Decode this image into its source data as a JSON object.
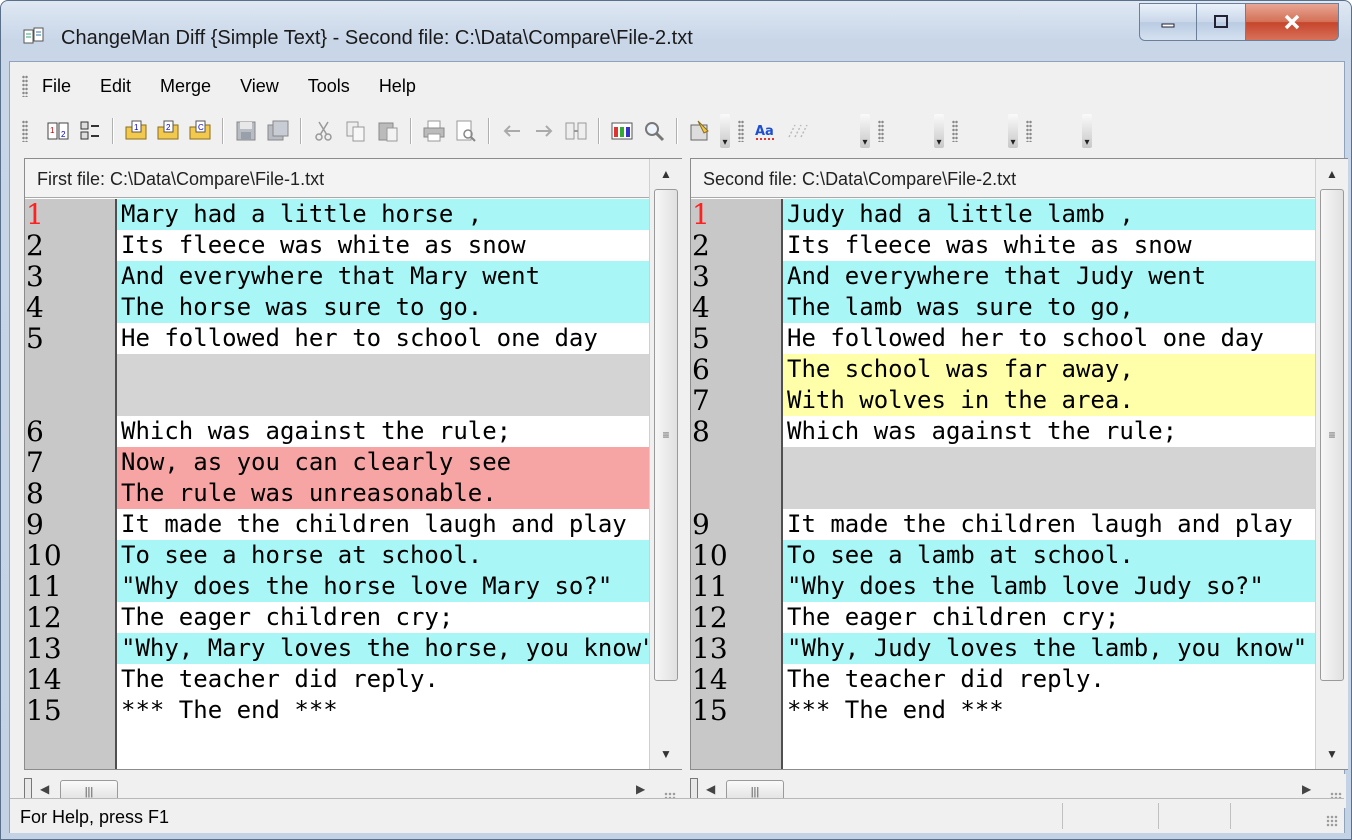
{
  "window": {
    "title": "ChangeMan Diff {Simple Text} - Second file: C:\\Data\\Compare\\File-2.txt",
    "controls": [
      "minimize",
      "maximize",
      "close"
    ]
  },
  "menu": [
    {
      "label": "File"
    },
    {
      "label": "Edit"
    },
    {
      "label": "Merge"
    },
    {
      "label": "View"
    },
    {
      "label": "Tools"
    },
    {
      "label": "Help"
    }
  ],
  "toolbar": {
    "icons": [
      "compare-icon",
      "options-icon",
      "open-first-file-icon",
      "open-second-file-icon",
      "open-third-file-icon",
      "save-icon",
      "save-all-icon",
      "cut-icon",
      "copy-icon",
      "paste-icon",
      "print-icon",
      "print-preview-icon",
      "arrow-left-icon",
      "arrow-right-icon",
      "merge-icon",
      "columns-icon",
      "find-icon",
      "properties-icon",
      "font-icon",
      "whitespace-icon"
    ]
  },
  "left_pane": {
    "header": "First file: C:\\Data\\Compare\\File-1.txt",
    "lines": [
      {
        "num": "1",
        "text": "Mary had a little horse ,",
        "bg": "cyan",
        "num_color": "red"
      },
      {
        "num": "2",
        "text": "Its fleece was white as snow",
        "bg": "white"
      },
      {
        "num": "3",
        "text": "And everywhere that Mary went",
        "bg": "cyan"
      },
      {
        "num": "4",
        "text": "The horse was sure to go.",
        "bg": "cyan"
      },
      {
        "num": "5",
        "text": "He followed her to school one day",
        "bg": "white"
      },
      {
        "num": "",
        "text": "",
        "bg": "gray"
      },
      {
        "num": "",
        "text": "",
        "bg": "gray"
      },
      {
        "num": "6",
        "text": "Which was against the rule;",
        "bg": "white"
      },
      {
        "num": "7",
        "text": "Now, as you can clearly see",
        "bg": "red"
      },
      {
        "num": "8",
        "text": "The rule was unreasonable.",
        "bg": "red"
      },
      {
        "num": "9",
        "text": "It made the children laugh and play",
        "bg": "white"
      },
      {
        "num": "10",
        "text": "To see a horse at school.",
        "bg": "cyan"
      },
      {
        "num": "11",
        "text": "\"Why does the horse love Mary so?\"",
        "bg": "cyan"
      },
      {
        "num": "12",
        "text": "The eager children cry;",
        "bg": "white"
      },
      {
        "num": "13",
        "text": "\"Why, Mary loves the horse, you know\"",
        "bg": "cyan"
      },
      {
        "num": "14",
        "text": "The teacher did reply.",
        "bg": "white"
      },
      {
        "num": "15",
        "text": "*** The end ***",
        "bg": "white"
      }
    ]
  },
  "right_pane": {
    "header": "Second file: C:\\Data\\Compare\\File-2.txt",
    "lines": [
      {
        "num": "1",
        "text": "Judy had a little lamb ,",
        "bg": "cyan",
        "num_color": "red"
      },
      {
        "num": "2",
        "text": "Its fleece was white as snow",
        "bg": "white"
      },
      {
        "num": "3",
        "text": "And everywhere that Judy went",
        "bg": "cyan"
      },
      {
        "num": "4",
        "text": "The lamb was sure to go,",
        "bg": "cyan"
      },
      {
        "num": "5",
        "text": "He followed her to school one day",
        "bg": "white"
      },
      {
        "num": "6",
        "text": "The school was far away,",
        "bg": "yellow"
      },
      {
        "num": "7",
        "text": "With wolves in the area.",
        "bg": "yellow"
      },
      {
        "num": "8",
        "text": "Which was against the rule;",
        "bg": "white"
      },
      {
        "num": "",
        "text": "",
        "bg": "gray"
      },
      {
        "num": "",
        "text": "",
        "bg": "gray"
      },
      {
        "num": "9",
        "text": "It made the children laugh and play",
        "bg": "white"
      },
      {
        "num": "10",
        "text": "To see a lamb at school.",
        "bg": "cyan"
      },
      {
        "num": "11",
        "text": "\"Why does the lamb love Judy so?\"",
        "bg": "cyan"
      },
      {
        "num": "12",
        "text": "The eager children cry;",
        "bg": "white"
      },
      {
        "num": "13",
        "text": "\"Why, Judy loves the lamb, you know\"",
        "bg": "cyan"
      },
      {
        "num": "14",
        "text": "The teacher did reply.",
        "bg": "white"
      },
      {
        "num": "15",
        "text": "*** The end ***",
        "bg": "white"
      }
    ]
  },
  "status": {
    "text": "For Help, press F1"
  },
  "colors": {
    "changed": "#a8f6f6",
    "deleted": "#f6a4a4",
    "inserted": "#ffffaa",
    "placeholder": "#d4d4d4",
    "line_number_highlight": "#ff2020"
  }
}
